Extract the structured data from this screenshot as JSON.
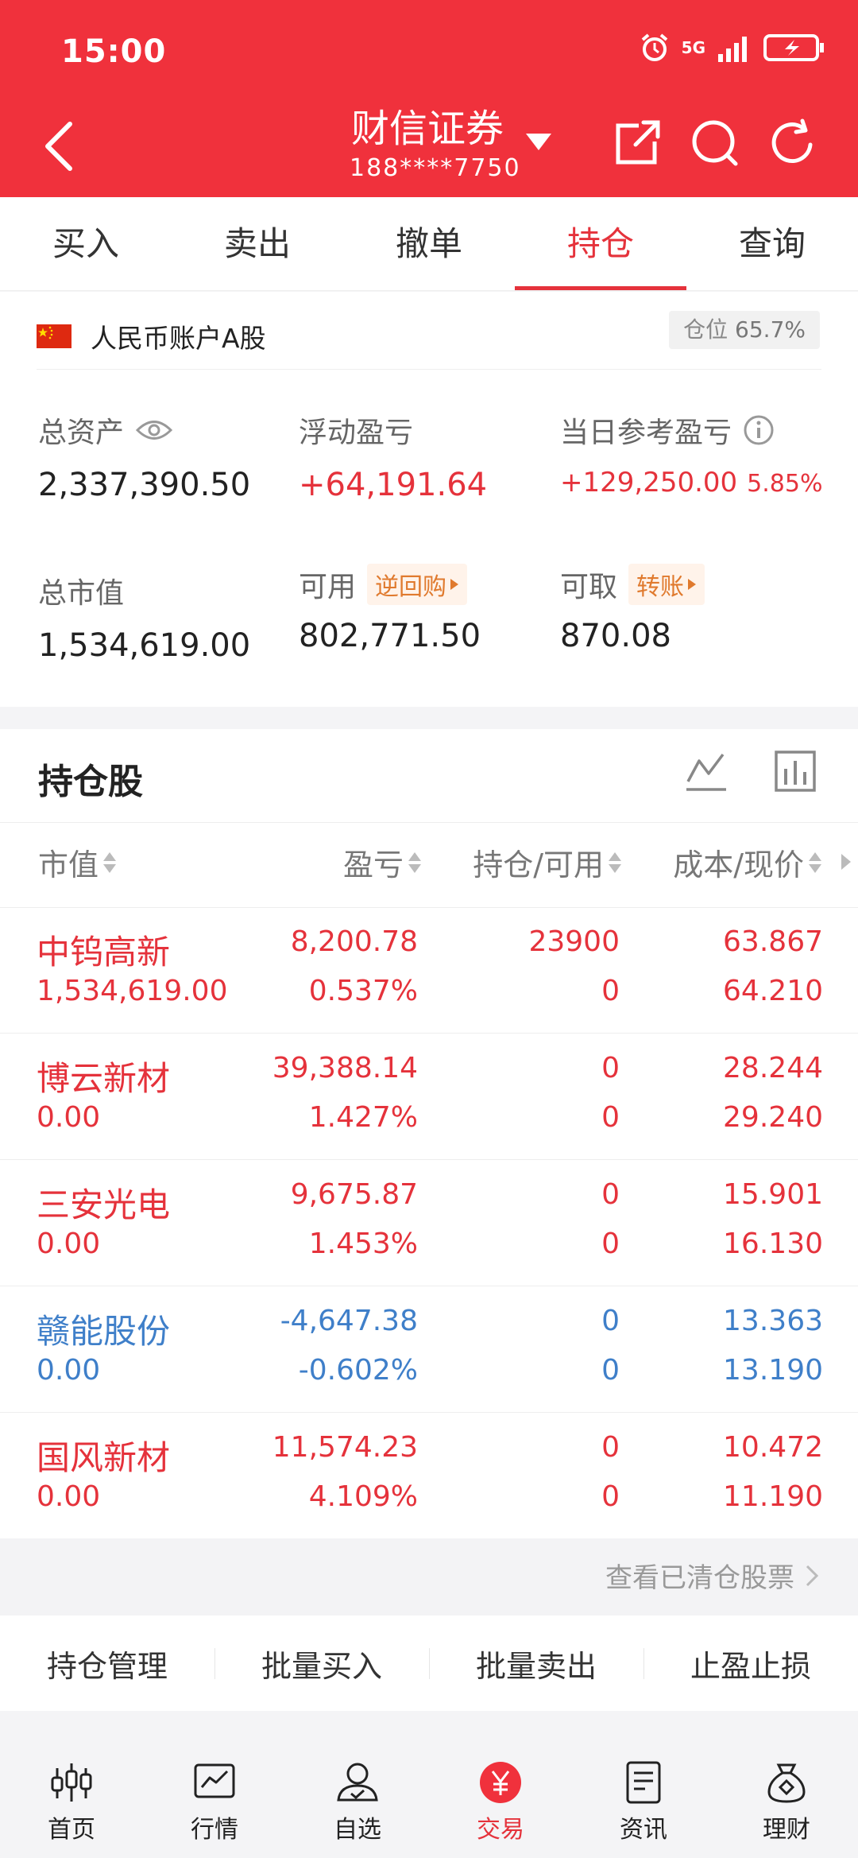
{
  "status_bar": {
    "time": "15:00",
    "network": "5G"
  },
  "nav": {
    "title": "财信证券",
    "account": "188****7750"
  },
  "tabs": [
    "买入",
    "卖出",
    "撤单",
    "持仓",
    "查询"
  ],
  "account": {
    "name": "人民币账户A股",
    "position_label": "仓位",
    "position_value": "65.7%",
    "total_assets_label": "总资产",
    "total_assets": "2,337,390.50",
    "floating_pl_label": "浮动盈亏",
    "floating_pl": "+64,191.64",
    "daily_pl_label": "当日参考盈亏",
    "daily_pl": "+129,250.00",
    "daily_pl_pct": "5.85%",
    "market_value_label": "总市值",
    "market_value": "1,534,619.00",
    "available_label": "可用",
    "reverse_repo": "逆回购",
    "available": "802,771.50",
    "withdrawable_label": "可取",
    "transfer": "转账",
    "withdrawable": "870.08"
  },
  "holdings": {
    "title": "持仓股",
    "columns": [
      "市值",
      "盈亏",
      "持仓/可用",
      "成本/现价"
    ],
    "rows": [
      {
        "name": "中钨高新",
        "mv": "1,534,619.00",
        "pl": "8,200.78",
        "plp": "0.537%",
        "hold": "23900",
        "avail": "0",
        "cost": "63.867",
        "price": "64.210",
        "tone": "red"
      },
      {
        "name": "博云新材",
        "mv": "0.00",
        "pl": "39,388.14",
        "plp": "1.427%",
        "hold": "0",
        "avail": "0",
        "cost": "28.244",
        "price": "29.240",
        "tone": "red"
      },
      {
        "name": "三安光电",
        "mv": "0.00",
        "pl": "9,675.87",
        "plp": "1.453%",
        "hold": "0",
        "avail": "0",
        "cost": "15.901",
        "price": "16.130",
        "tone": "red"
      },
      {
        "name": "赣能股份",
        "mv": "0.00",
        "pl": "-4,647.38",
        "plp": "-0.602%",
        "hold": "0",
        "avail": "0",
        "cost": "13.363",
        "price": "13.190",
        "tone": "blue"
      },
      {
        "name": "国风新材",
        "mv": "0.00",
        "pl": "11,574.23",
        "plp": "4.109%",
        "hold": "0",
        "avail": "0",
        "cost": "10.472",
        "price": "11.190",
        "tone": "red"
      }
    ],
    "cleared_link": "查看已清仓股票"
  },
  "actions": [
    "持仓管理",
    "批量买入",
    "批量卖出",
    "止盈止损"
  ],
  "bottom_nav": [
    {
      "label": "首页",
      "icon": "candlestick-icon"
    },
    {
      "label": "行情",
      "icon": "market-chart-icon"
    },
    {
      "label": "自选",
      "icon": "user-check-icon"
    },
    {
      "label": "交易",
      "icon": "yuan-icon"
    },
    {
      "label": "资讯",
      "icon": "document-icon"
    },
    {
      "label": "理财",
      "icon": "money-bag-icon"
    }
  ],
  "colors": {
    "brand": "#f0313c",
    "up": "#e5323b",
    "down": "#3f7fc9"
  }
}
